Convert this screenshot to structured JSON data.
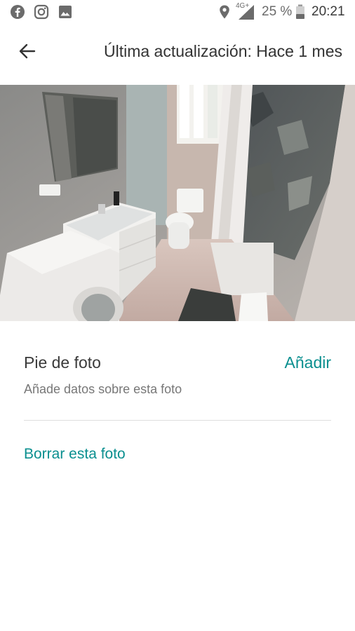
{
  "status_bar": {
    "notification_icons": [
      "facebook-icon",
      "instagram-icon",
      "gallery-icon"
    ],
    "network": "4G+",
    "battery": "25 %",
    "time": "20:21"
  },
  "toolbar": {
    "back_icon": "arrow-back-icon",
    "title": "Última actualización: Hace 1 mes"
  },
  "photo": {
    "edit_icon": "pencil-icon"
  },
  "caption": {
    "label": "Pie de foto",
    "add_label": "Añadir",
    "hint": "Añade datos sobre esta foto"
  },
  "actions": {
    "delete_label": "Borrar esta foto"
  },
  "colors": {
    "accent": "#0a8f8f",
    "text_primary": "#333333",
    "text_secondary": "#777777",
    "divider": "#dedede"
  }
}
